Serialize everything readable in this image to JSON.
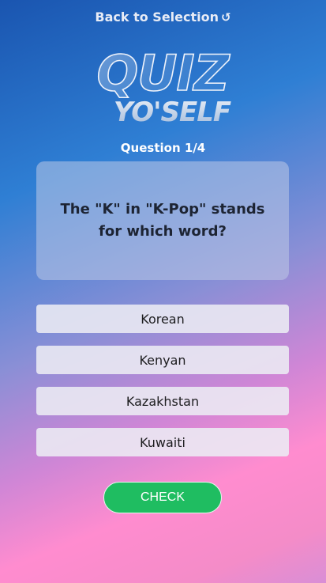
{
  "header": {
    "back_label": "Back to Selection",
    "back_icon": "undo-icon"
  },
  "logo": {
    "line1": "QUIZ",
    "line2": "YO'SELF"
  },
  "quiz": {
    "counter": "Question 1/4",
    "question": "The \"K\" in \"K-Pop\" stands for which word?",
    "options": [
      {
        "label": "Korean"
      },
      {
        "label": "Kenyan"
      },
      {
        "label": "Kazakhstan"
      },
      {
        "label": "Kuwaiti"
      }
    ],
    "check_label": "CHECK"
  },
  "colors": {
    "check_button": "#1fbd61",
    "gradient_top": "#1a55b0",
    "gradient_bottom": "#ff8ccf"
  }
}
